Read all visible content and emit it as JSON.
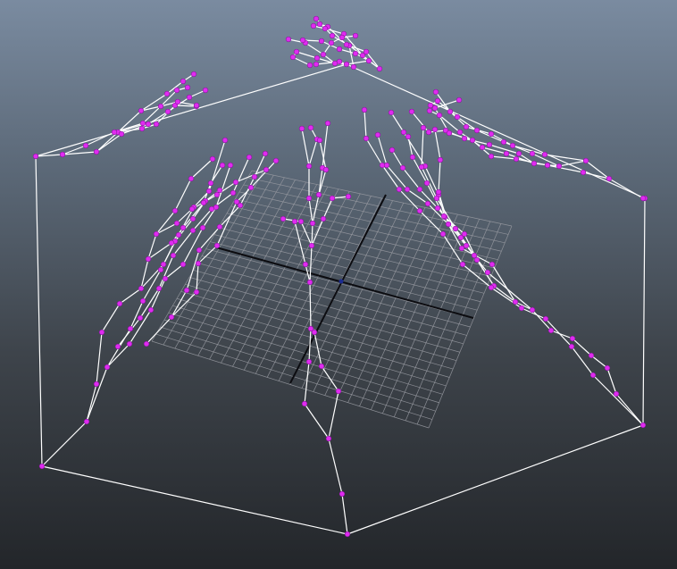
{
  "viewport": {
    "name": "3d-viewport",
    "background_top": "#7a8ba0",
    "background_bottom": "#23262a"
  },
  "colors": {
    "bone": "#ffffff",
    "joint": "#e02bf0",
    "joint_outline": "#8a1aa0",
    "grid_line": "#9a9ca3",
    "grid_axis": "#0c0c10",
    "origin": "#1c2c90"
  },
  "icons": {
    "joint": "joint-icon"
  }
}
